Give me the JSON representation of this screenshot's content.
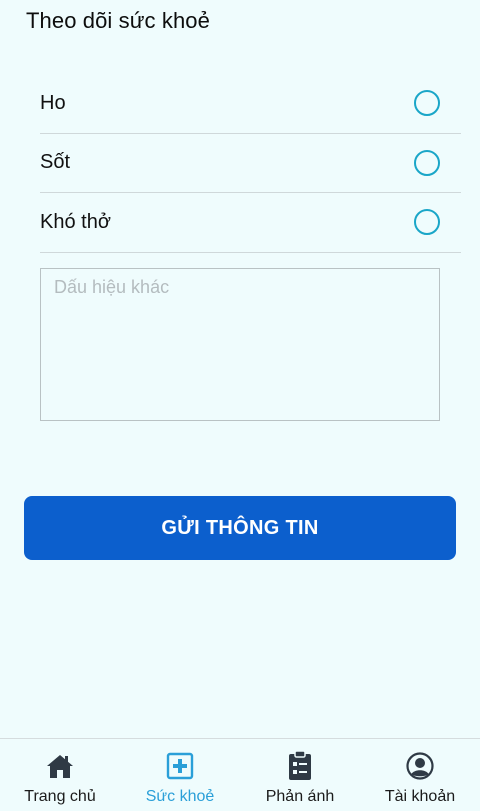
{
  "header": {
    "title": "Theo dõi sức khoẻ"
  },
  "symptoms": [
    {
      "label": "Ho"
    },
    {
      "label": "Sốt"
    },
    {
      "label": "Khó thở"
    }
  ],
  "other_signs": {
    "placeholder": "Dấu hiệu khác",
    "value": ""
  },
  "submit": {
    "label": "GỬI THÔNG TIN"
  },
  "tabs": [
    {
      "label": "Trang chủ",
      "icon": "home-icon",
      "active": false
    },
    {
      "label": "Sức khoẻ",
      "icon": "medical-cross-icon",
      "active": true
    },
    {
      "label": "Phản ánh",
      "icon": "clipboard-icon",
      "active": false
    },
    {
      "label": "Tài khoản",
      "icon": "user-circle-icon",
      "active": false
    }
  ],
  "colors": {
    "background": "#effcfd",
    "primary": "#0c5fcd",
    "radio": "#1aa6c8",
    "active_tab": "#2a9fd8"
  }
}
